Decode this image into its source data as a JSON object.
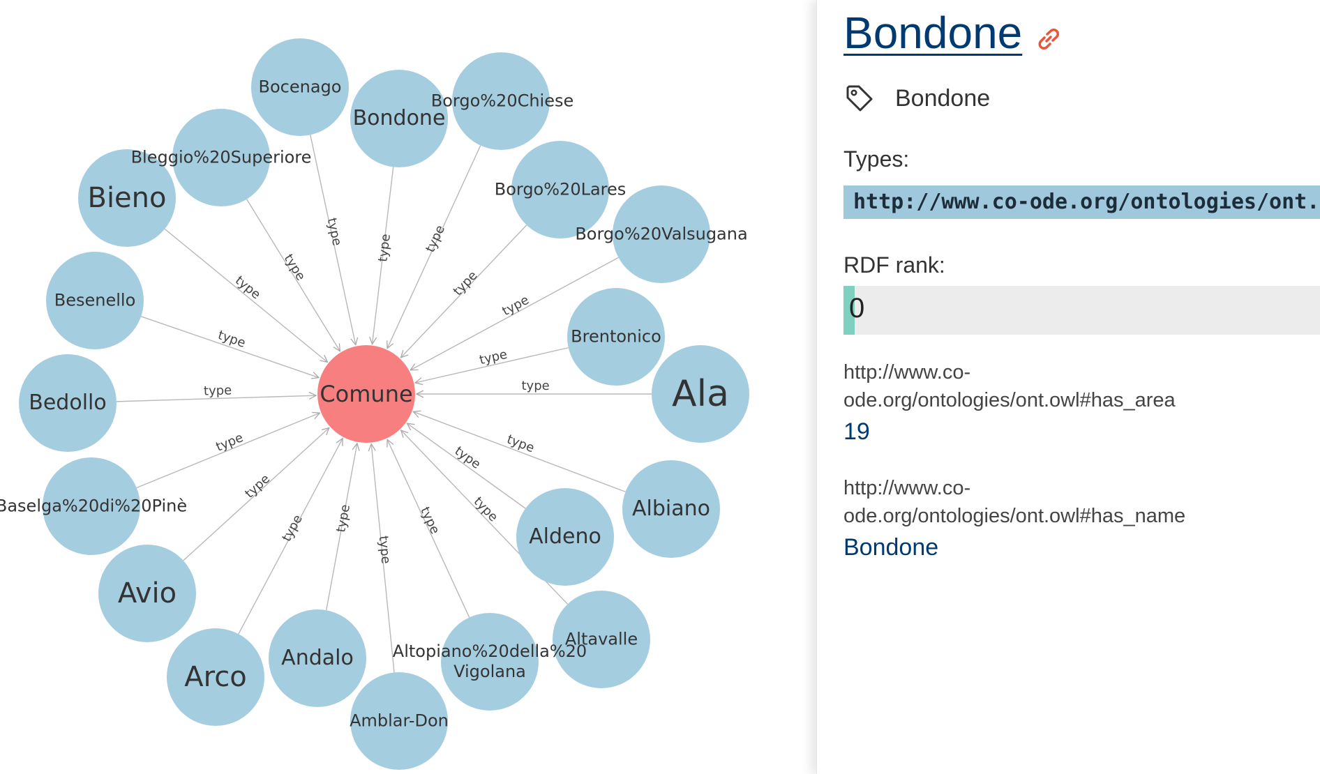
{
  "graph": {
    "center": {
      "label": "Comune"
    },
    "edge_label": "type",
    "nodes": [
      {
        "id": "bocenago",
        "label": "Bocenago",
        "size": "s"
      },
      {
        "id": "bondone",
        "label": "Bondone",
        "size": "m"
      },
      {
        "id": "borgo-chiese",
        "label": "Borgo%20Chiese",
        "size": "s"
      },
      {
        "id": "bleggio-superiore",
        "label": "Bleggio%20Superiore",
        "size": "s"
      },
      {
        "id": "borgo-lares",
        "label": "Borgo%20Lares",
        "size": "s"
      },
      {
        "id": "bieno",
        "label": "Bieno",
        "size": "l"
      },
      {
        "id": "borgo-valsugana",
        "label": "Borgo%20Valsugana",
        "size": "s"
      },
      {
        "id": "besenello",
        "label": "Besenello",
        "size": "s"
      },
      {
        "id": "brentonico",
        "label": "Brentonico",
        "size": "s"
      },
      {
        "id": "bedollo",
        "label": "Bedollo",
        "size": "m"
      },
      {
        "id": "ala",
        "label": "Ala",
        "size": "xl"
      },
      {
        "id": "baselga-di-pine",
        "label": "Baselga%20di%20Pinè",
        "size": "s"
      },
      {
        "id": "albiano",
        "label": "Albiano",
        "size": "m"
      },
      {
        "id": "aldeno",
        "label": "Aldeno",
        "size": "m"
      },
      {
        "id": "avio",
        "label": "Avio",
        "size": "l"
      },
      {
        "id": "altavalle",
        "label": "Altavalle",
        "size": "s"
      },
      {
        "id": "arco",
        "label": "Arco",
        "size": "l"
      },
      {
        "id": "andalo",
        "label": "Andalo",
        "size": "m"
      },
      {
        "id": "altopiano-vigolana",
        "label": "Altopiano%20della%20\nVigolana",
        "size": "s"
      },
      {
        "id": "amblar-don",
        "label": "Amblar-Don",
        "size": "s"
      }
    ]
  },
  "panel": {
    "title": "Bondone",
    "label": "Bondone",
    "types_heading": "Types:",
    "type_uri": "http://www.co-ode.org/ontologies/ont.owl#Comune",
    "rank_heading": "RDF rank:",
    "rank_value": "0",
    "rank_fraction": 0,
    "properties": [
      {
        "uri": "http://www.co-ode.org/ontologies/ont.owl#has_area",
        "value": "19"
      },
      {
        "uri": "http://www.co-ode.org/ontologies/ont.owl#has_name",
        "value": "Bondone"
      }
    ]
  },
  "colors": {
    "node_fill": "#a5cde0",
    "center_fill": "#f77f7f",
    "edge": "#b8b8b8",
    "title": "#003a70",
    "link_icon": "#e8553a",
    "rank_fill": "#7fd0bf"
  }
}
